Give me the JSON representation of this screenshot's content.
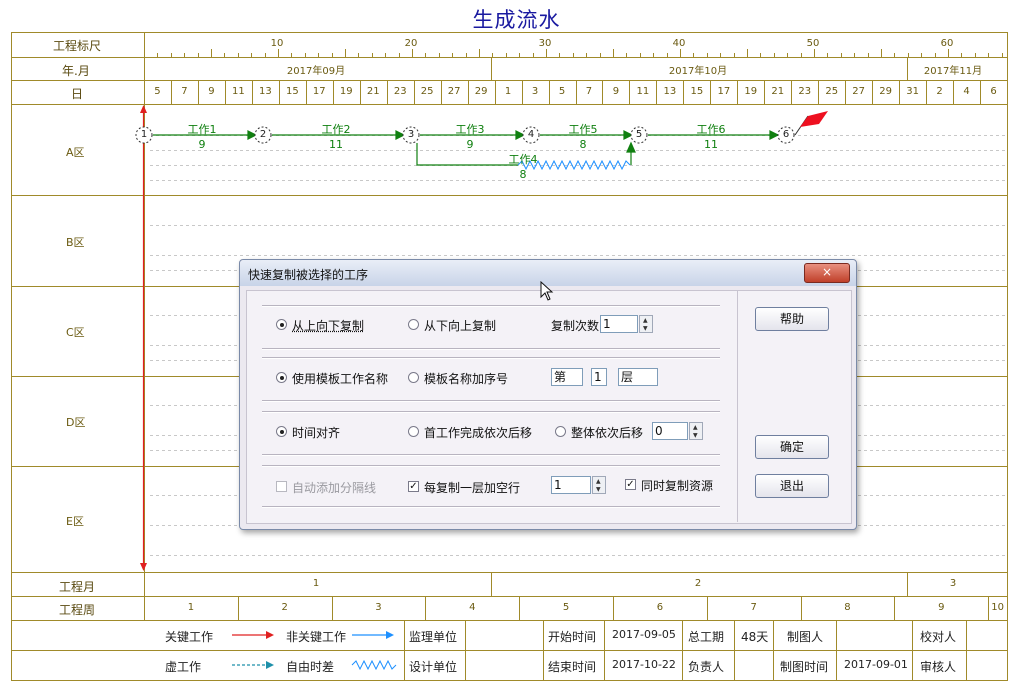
{
  "title": "生成流水",
  "header": {
    "scale_label": "工程标尺",
    "month_label": "年.月",
    "day_label": "日",
    "scale_ticks": [
      "10",
      "20",
      "30",
      "40",
      "50",
      "60"
    ],
    "months": [
      "2017年09月",
      "2017年10月",
      "2017年11月"
    ],
    "days": [
      "5",
      "7",
      "9",
      "11",
      "13",
      "15",
      "17",
      "19",
      "21",
      "23",
      "25",
      "27",
      "29",
      "1",
      "3",
      "5",
      "7",
      "9",
      "11",
      "13",
      "15",
      "17",
      "19",
      "21",
      "23",
      "25",
      "27",
      "29",
      "31",
      "2",
      "4",
      "6"
    ]
  },
  "zones": [
    "A区",
    "B区",
    "C区",
    "D区",
    "E区"
  ],
  "network": {
    "nodes": [
      "1",
      "2",
      "3",
      "4",
      "5",
      "6"
    ],
    "works": [
      {
        "name": "工作1",
        "duration": "9"
      },
      {
        "name": "工作2",
        "duration": "11"
      },
      {
        "name": "工作3",
        "duration": "9"
      },
      {
        "name": "工作5",
        "duration": "8"
      },
      {
        "name": "工作6",
        "duration": "11"
      },
      {
        "name": "工作4",
        "duration": "8"
      }
    ]
  },
  "footer_rows": {
    "project_month_label": "工程月",
    "project_months": [
      "1",
      "2",
      "3"
    ],
    "project_week_label": "工程周",
    "project_weeks": [
      "1",
      "2",
      "3",
      "4",
      "5",
      "6",
      "7",
      "8",
      "9",
      "10"
    ]
  },
  "legend": {
    "critical": "关键工作",
    "noncritical": "非关键工作",
    "dummy": "虚工作",
    "free_float": "自由时差"
  },
  "info": {
    "supervisor_label": "监理单位",
    "designer_label": "设计单位",
    "start_label": "开始时间",
    "start_value": "2017-09-05",
    "end_label": "结束时间",
    "end_value": "2017-10-22",
    "total_label": "总工期",
    "total_value": "48天",
    "owner_label": "负责人",
    "drawer_label": "制图人",
    "draw_time_label": "制图时间",
    "draw_time_value": "2017-09-01",
    "checker_label": "校对人",
    "reviewer_label": "审核人"
  },
  "dialog": {
    "title": "快速复制被选择的工序",
    "close": "×",
    "top_down": "从上向下复制",
    "bottom_up": "从下向上复制",
    "copy_count_label": "复制次数",
    "copy_count_value": "1",
    "use_template_name": "使用模板工作名称",
    "template_seq": "模板名称加序号",
    "prefix": "第",
    "layer_value": "1",
    "suffix": "层",
    "time_align": "时间对齐",
    "first_shift": "首工作完成依次后移",
    "whole_shift": "整体依次后移",
    "shift_value": "0",
    "auto_separator": "自动添加分隔线",
    "blank_row": "每复制一层加空行",
    "blank_row_value": "1",
    "copy_resource": "同时复制资源",
    "help": "帮助",
    "ok": "确定",
    "exit": "退出"
  },
  "colors": {
    "grid": "#a08a2a",
    "critical": "#e02020",
    "noncritical": "#1e90ff",
    "work": "#108010",
    "dialog_bg": "#ece9f0"
  }
}
